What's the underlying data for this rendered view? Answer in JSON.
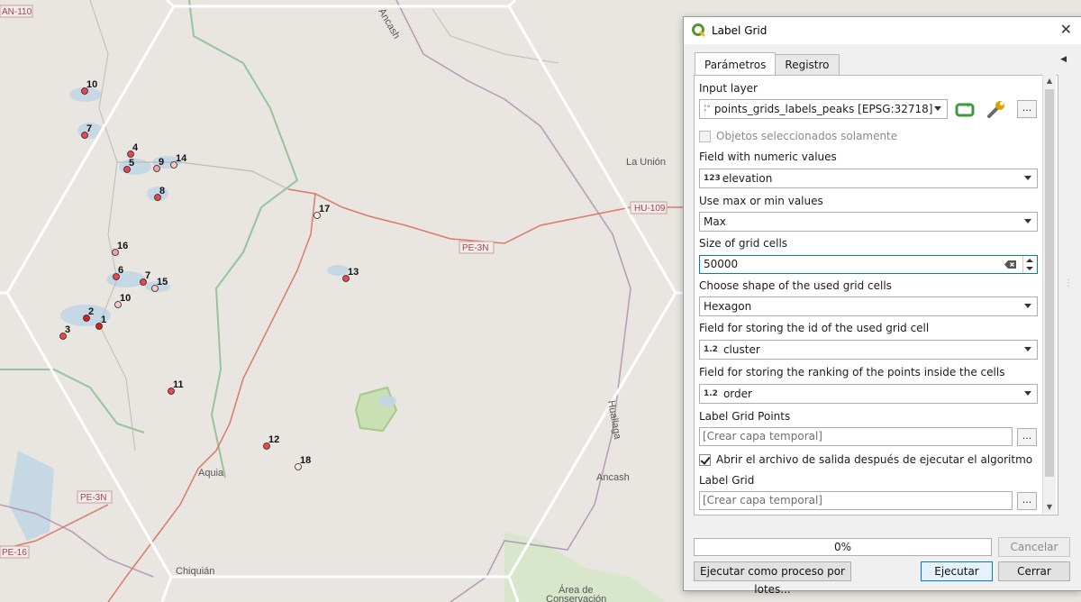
{
  "map": {
    "place_labels": [
      "La Unión",
      "Aquia",
      "Chiquián",
      "Área de",
      "Conservación"
    ],
    "road_labels": [
      "AN-110",
      "HU-109",
      "PE-3N",
      "PE-3N",
      "PE-16"
    ],
    "river_labels": [
      "Ancash",
      "Huallaga",
      "Ancash"
    ],
    "peaks": [
      "10",
      "7",
      "4",
      "5",
      "9",
      "14",
      "8",
      "17",
      "16",
      "6",
      "7",
      "15",
      "10",
      "2",
      "1",
      "3",
      "13",
      "11",
      "12",
      "18"
    ]
  },
  "dialog": {
    "title": "Label Grid",
    "tabs": [
      "Parámetros",
      "Registro"
    ],
    "input_layer_label": "Input layer",
    "input_layer_value": "points_grids_labels_peaks [EPSG:32718]",
    "selected_only_label": "Objetos seleccionados solamente",
    "numeric_field_label": "Field with numeric values",
    "numeric_field_type": "123",
    "numeric_field_value": "elevation",
    "maxmin_label": "Use max or min values",
    "maxmin_value": "Max",
    "cell_size_label": "Size of grid cells",
    "cell_size_value": "50000",
    "shape_label": "Choose shape of the used grid cells",
    "shape_value": "Hexagon",
    "id_field_label": "Field for storing the id of the used grid cell",
    "id_field_type": "1.2",
    "id_field_value": "cluster",
    "rank_field_label": "Field for storing the ranking of  the points inside the cells",
    "rank_field_type": "1.2",
    "rank_field_value": "order",
    "points_out_label": "Label Grid Points",
    "points_out_value": "[Crear capa temporal]",
    "open_after_label": "Abrir el archivo de salida después de ejecutar el algoritmo",
    "grid_out_label": "Label Grid",
    "grid_out_value": "[Crear capa temporal]",
    "dots": "...",
    "progress_text": "0%",
    "cancel_label": "Cancelar",
    "batch_label": "Ejecutar como proceso por lotes...",
    "run_label": "Ejecutar",
    "close_label": "Cerrar",
    "close_glyph": "✕"
  },
  "colors": {
    "accent": "#0078d7",
    "hex_grid": "#ffffff",
    "peak_fill": "#e8474b",
    "road": "#d97a6a"
  }
}
